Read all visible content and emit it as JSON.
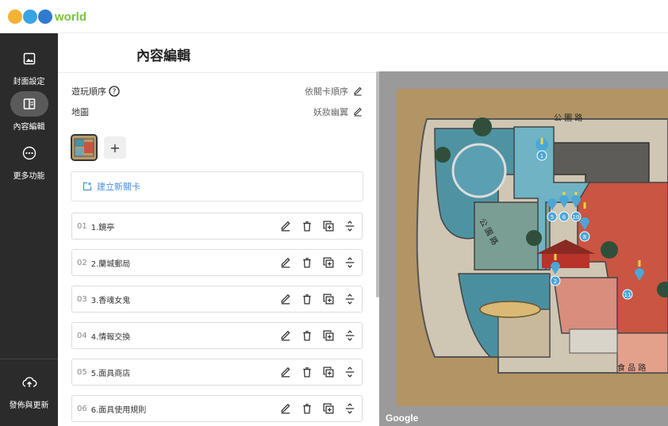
{
  "app": {
    "logo_text": "world",
    "logo_dot_colors": [
      "#f5b335",
      "#3aa3e3",
      "#2f7bd1"
    ]
  },
  "sidebar": {
    "items": [
      {
        "label": "封面設定",
        "icon": "image-icon",
        "active": false
      },
      {
        "label": "內容編輯",
        "icon": "layout-icon",
        "active": true
      },
      {
        "label": "更多功能",
        "icon": "more-icon",
        "active": false
      }
    ],
    "publish_label": "發佈與更新"
  },
  "header": {
    "title": "內容編輯"
  },
  "settings": {
    "play_order_label": "遊玩順序",
    "play_order_value": "依關卡順序",
    "map_label": "地圖",
    "map_value": "妖妝幽翼"
  },
  "new_card_label": "建立新關卡",
  "cards": [
    {
      "num": "01",
      "title": "1.鏡亭"
    },
    {
      "num": "02",
      "title": "2.蘭城郵局"
    },
    {
      "num": "03",
      "title": "3.香魂女鬼"
    },
    {
      "num": "04",
      "title": "4.情報交換"
    },
    {
      "num": "05",
      "title": "5.面具商店"
    },
    {
      "num": "06",
      "title": "6.面具使用規則"
    }
  ],
  "map": {
    "road_top": "公 園 路",
    "road_left": "公 園 路",
    "road_bottom": "食 品 路",
    "google_label": "Google",
    "pins": [
      "1",
      "5",
      "6",
      "10",
      "8",
      "2",
      "11"
    ]
  }
}
